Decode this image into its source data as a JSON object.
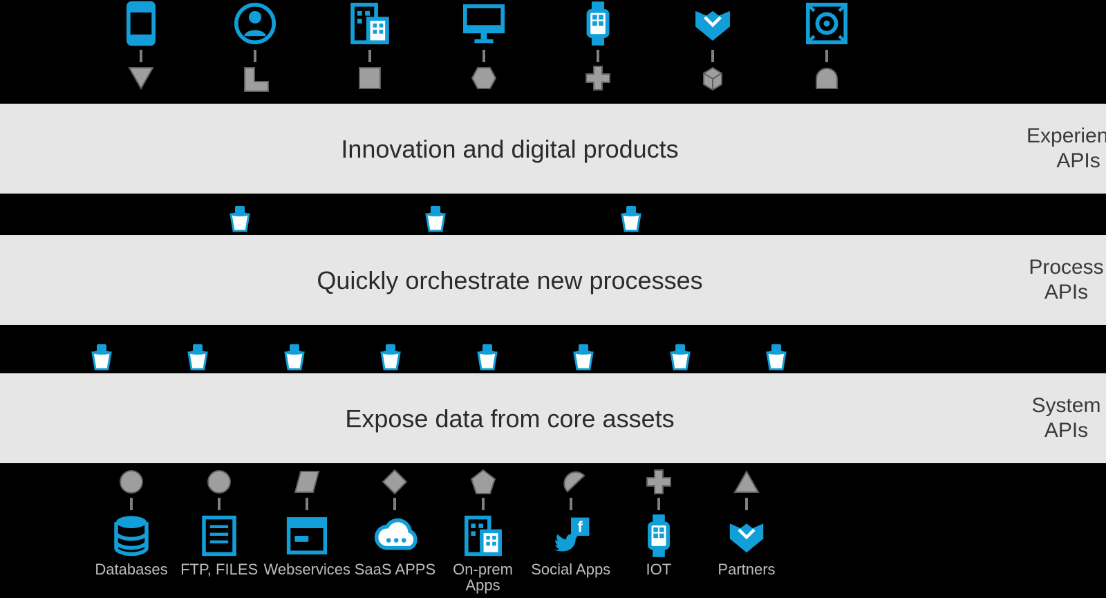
{
  "colors": {
    "brand": "#129fd9",
    "brand_dark": "#0a83b5",
    "grey": "#9e9e9e",
    "grey_dark": "#7f7f7f",
    "band": "#e6e6e6",
    "text": "#2b2b2b",
    "caption": "#bdbdbd"
  },
  "layers": [
    {
      "id": "experience",
      "band_text": "Innovation and digital products",
      "side_label": "Experience APIs"
    },
    {
      "id": "process",
      "band_text": "Quickly orchestrate new processes",
      "side_label": "Process APIs"
    },
    {
      "id": "system",
      "band_text": "Expose data from core assets",
      "side_label": "System APIs"
    }
  ],
  "top_channels": [
    {
      "id": "mobile",
      "icon": "mobile",
      "shape": "triangle-down"
    },
    {
      "id": "user",
      "icon": "user",
      "shape": "l-corner"
    },
    {
      "id": "enterprise",
      "icon": "building",
      "shape": "square"
    },
    {
      "id": "desktop",
      "icon": "desktop",
      "shape": "hexagon"
    },
    {
      "id": "wearable",
      "icon": "watch",
      "shape": "plus"
    },
    {
      "id": "handshake",
      "icon": "handshake",
      "shape": "cube"
    },
    {
      "id": "camera",
      "icon": "camera",
      "shape": "arch"
    }
  ],
  "process_nodes": 3,
  "system_nodes": 8,
  "bottom_sources": [
    {
      "id": "databases",
      "icon": "database",
      "shape": "circle",
      "label": "Databases"
    },
    {
      "id": "ftp",
      "icon": "document",
      "shape": "circle",
      "label": "FTP, FILES"
    },
    {
      "id": "webservices",
      "icon": "browser",
      "shape": "parallelogram",
      "label": "Webservices"
    },
    {
      "id": "saas",
      "icon": "cloud",
      "shape": "diamond",
      "label": "SaaS APPS"
    },
    {
      "id": "onprem",
      "icon": "building",
      "shape": "pentagon",
      "label": "On-prem Apps"
    },
    {
      "id": "social",
      "icon": "social",
      "shape": "droplet",
      "label": "Social Apps"
    },
    {
      "id": "iot",
      "icon": "watch",
      "shape": "plus",
      "label": "IOT"
    },
    {
      "id": "partners",
      "icon": "handshake",
      "shape": "triangle-up",
      "label": "Partners"
    }
  ]
}
